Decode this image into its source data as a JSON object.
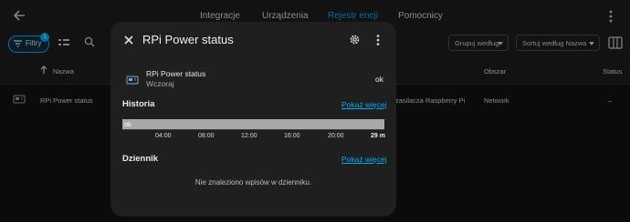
{
  "tabs": [
    {
      "label": "Integracje"
    },
    {
      "label": "Urządzenia"
    },
    {
      "label": "Rejestr encji"
    },
    {
      "label": "Pomocnicy"
    }
  ],
  "toolbar": {
    "filters_label": "Filtry",
    "filters_count": "1",
    "group_label": "Grupuj według",
    "sort_label": "Sortuj według Nazwa"
  },
  "table": {
    "headers": {
      "name": "Nazwa",
      "area": "Obszar",
      "status": "Status"
    },
    "row": {
      "name": "RPi Power status",
      "device": "zasilacza Raspberry Pi",
      "area": "Network",
      "status": "–"
    }
  },
  "dialog": {
    "title": "RPi Power status",
    "entity_name": "RPi Power status",
    "entity_time": "Wczoraj",
    "entity_state": "ok",
    "history_title": "Historia",
    "history_more": "Pokaż więcej",
    "history_bar_label": "ok",
    "ticks": [
      "04:00",
      "08:00",
      "12:00",
      "16:00",
      "20:00",
      "29 m"
    ],
    "log_title": "Dziennik",
    "log_more": "Pokaż więcej",
    "log_empty": "Nie znaleziono wpisów w dzienniku."
  },
  "colors": {
    "accent": "#03a9f4",
    "dialog_bg": "#1f1f1f",
    "bar": "#a8a8a8"
  }
}
